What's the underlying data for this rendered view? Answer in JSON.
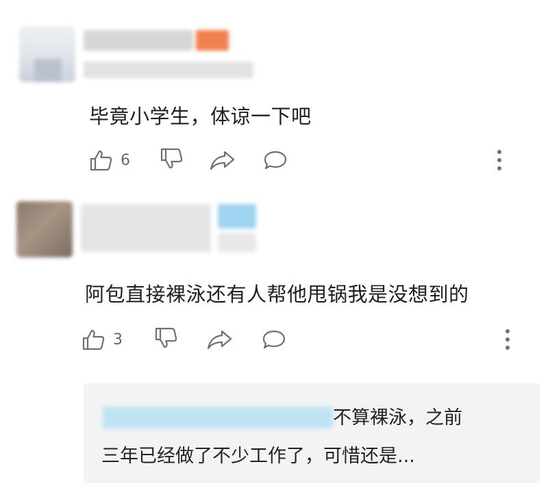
{
  "comments": [
    {
      "text": "毕竟小学生，体谅一下吧",
      "likes": "6"
    },
    {
      "text": "阿包直接裸泳还有人帮他甩锅我是没想到的",
      "likes": "3",
      "reply": {
        "line1": "不算裸泳，之前",
        "line2": "三年已经做了不少工作了，可惜还是..."
      }
    }
  ],
  "colors": {
    "icon": "#6f6f6f",
    "reply_bg": "#f3f3f3",
    "badge_orange": "#f08050",
    "badge_blue": "#9ed4f0"
  }
}
